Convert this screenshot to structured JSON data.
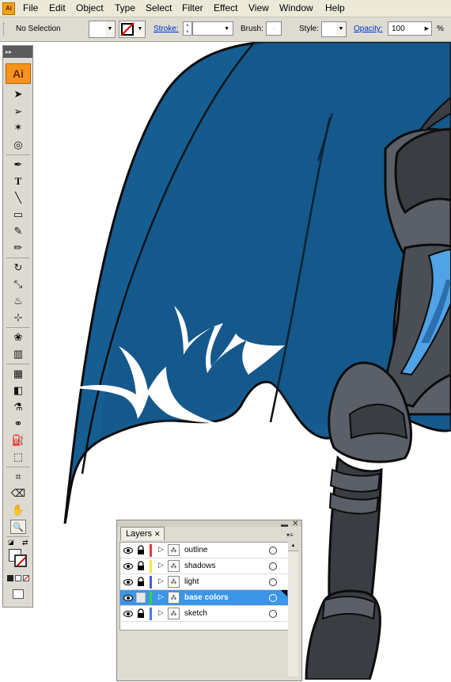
{
  "menubar": {
    "items": [
      "File",
      "Edit",
      "Object",
      "Type",
      "Select",
      "Filter",
      "Effect",
      "View",
      "Window",
      "Help"
    ]
  },
  "controlbar": {
    "selection_label": "No Selection",
    "stroke_label": "Stroke:",
    "brush_label": "Brush:",
    "style_label": "Style:",
    "opacity_label": "Opacity:",
    "opacity_value": "100",
    "opacity_unit": "%"
  },
  "tools": {
    "logo": "Ai",
    "items": [
      {
        "name": "selection-tool-icon",
        "glyph": "➤"
      },
      {
        "name": "direct-selection-tool-icon",
        "glyph": "➢"
      },
      {
        "name": "magic-wand-tool-icon",
        "glyph": "✶"
      },
      {
        "name": "lasso-tool-icon",
        "glyph": "◎"
      },
      {
        "name": "pen-tool-icon",
        "glyph": "✒"
      },
      {
        "name": "type-tool-icon",
        "glyph": "T"
      },
      {
        "name": "line-tool-icon",
        "glyph": "╲"
      },
      {
        "name": "rectangle-tool-icon",
        "glyph": "▭"
      },
      {
        "name": "paintbrush-tool-icon",
        "glyph": "✎"
      },
      {
        "name": "pencil-tool-icon",
        "glyph": "✏"
      },
      {
        "name": "rotate-tool-icon",
        "glyph": "↻"
      },
      {
        "name": "scale-tool-icon",
        "glyph": "⤡"
      },
      {
        "name": "warp-tool-icon",
        "glyph": "♨"
      },
      {
        "name": "free-transform-tool-icon",
        "glyph": "⊹"
      },
      {
        "name": "symbol-sprayer-tool-icon",
        "glyph": "❀"
      },
      {
        "name": "column-graph-tool-icon",
        "glyph": "▥"
      },
      {
        "name": "mesh-tool-icon",
        "glyph": "▦"
      },
      {
        "name": "gradient-tool-icon",
        "glyph": "◧"
      },
      {
        "name": "eyedropper-tool-icon",
        "glyph": "⚗"
      },
      {
        "name": "blend-tool-icon",
        "glyph": "⚭"
      },
      {
        "name": "live-paint-bucket-tool-icon",
        "glyph": "⛽"
      },
      {
        "name": "live-paint-selection-tool-icon",
        "glyph": "⬚"
      },
      {
        "name": "slice-tool-icon",
        "glyph": "⌗"
      },
      {
        "name": "eraser-tool-icon",
        "glyph": "⌫"
      },
      {
        "name": "hand-tool-icon",
        "glyph": "✋"
      },
      {
        "name": "zoom-tool-icon",
        "glyph": "🔍"
      }
    ],
    "active_tool": "zoom-tool-icon"
  },
  "layers_panel": {
    "tab_label": "Layers",
    "layers": [
      {
        "name": "outline",
        "color": "#e83a3a",
        "locked": true,
        "visible": true,
        "selected": false
      },
      {
        "name": "shadows",
        "color": "#f5e63a",
        "locked": true,
        "visible": true,
        "selected": false
      },
      {
        "name": "light",
        "color": "#4a5ae6",
        "locked": true,
        "visible": true,
        "selected": false
      },
      {
        "name": "base colors",
        "color": "#3ad43a",
        "locked": false,
        "visible": true,
        "selected": true
      },
      {
        "name": "sketch",
        "color": "#4a7ae6",
        "locked": true,
        "visible": true,
        "selected": false
      }
    ]
  },
  "artwork": {
    "cape_color": "#165d92",
    "cape_highlight_color": "#ffffff",
    "armor_dark": "#3a3d42",
    "armor_mid": "#5b6068",
    "armor_light_blue": "#4fa3e6"
  }
}
